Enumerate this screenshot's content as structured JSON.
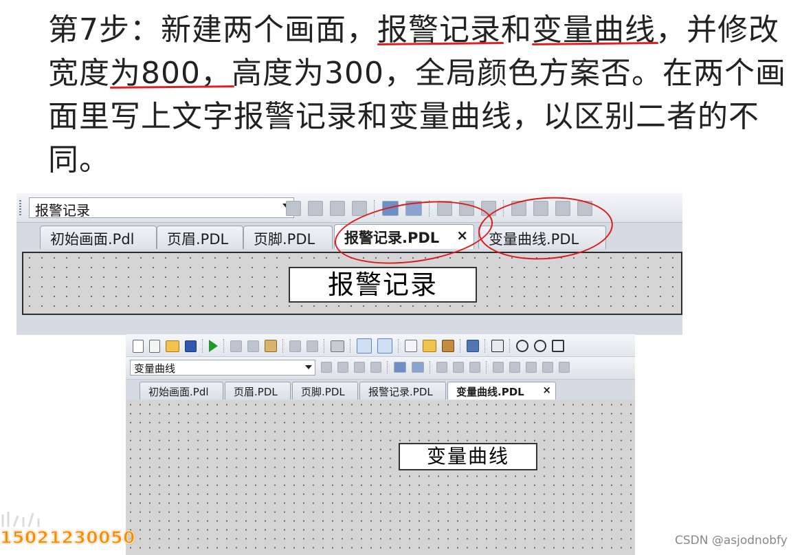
{
  "instruction": {
    "part1": "第7步：新建两个画面，",
    "hl1": "报警记录",
    "mid1": "和",
    "hl2": "变量曲线",
    "part2": "，并修改宽度",
    "hl3": "为800，",
    "part3": "高度为300，全局颜色方案否。在两个画面里写上文字报警记录和变量曲线，以区别二者的不同。"
  },
  "screenshot1": {
    "combo_value": "报警记录",
    "tabs": [
      {
        "label": "初始画面.Pdl",
        "active": false
      },
      {
        "label": "页眉.PDL",
        "active": false
      },
      {
        "label": "页脚.PDL",
        "active": false
      },
      {
        "label": "报警记录.PDL",
        "active": true
      },
      {
        "label": "变量曲线.PDL",
        "active": false
      }
    ],
    "close_glyph": "×",
    "canvas_text": "报警记录"
  },
  "screenshot2": {
    "combo_value": "变量曲线",
    "tabs": [
      {
        "label": "初始画面.Pdl",
        "active": false
      },
      {
        "label": "页眉.PDL",
        "active": false
      },
      {
        "label": "页脚.PDL",
        "active": false
      },
      {
        "label": "报警记录.PDL",
        "active": false
      },
      {
        "label": "变量曲线.PDL",
        "active": true
      }
    ],
    "close_glyph": "×",
    "canvas_text": "变量曲线"
  },
  "watermark_phone": "15021230050",
  "watermark_csdn": "CSDN @asjodnobfy",
  "colors": {
    "annotation": "#e01818",
    "watermark_phone": "#ff8c00",
    "canvas": "#d4d4d4"
  }
}
